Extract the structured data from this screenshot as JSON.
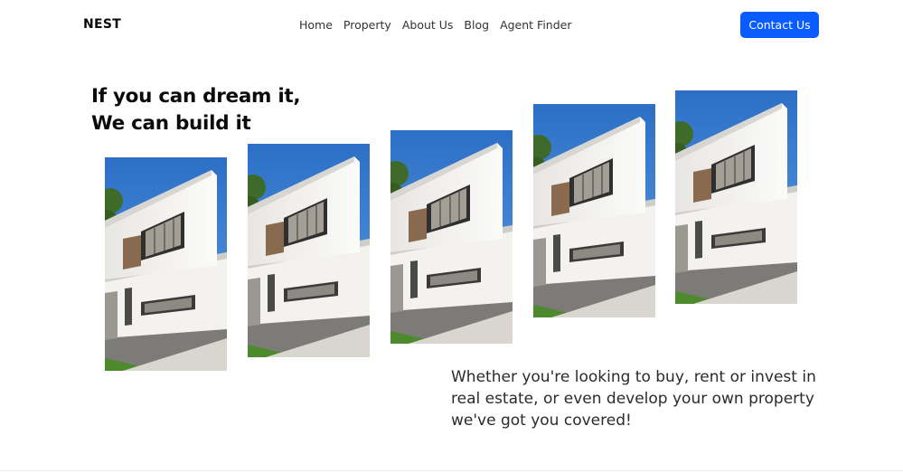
{
  "brand": {
    "name": "NEST"
  },
  "nav": {
    "items": [
      {
        "label": "Home"
      },
      {
        "label": "Property"
      },
      {
        "label": "About Us"
      },
      {
        "label": "Blog"
      },
      {
        "label": "Agent Finder"
      }
    ],
    "cta_label": "Contact Us"
  },
  "hero": {
    "headline_line1": "If you can dream it,",
    "headline_line2": "We can build it",
    "tagline": "Whether you're looking to buy, rent or invest in real estate, or even develop your own property we've got you covered!"
  },
  "gallery": {
    "photo_count": 5,
    "photo_subject": "modern-white-house"
  },
  "colors": {
    "accent": "#0a5cff",
    "sky": "#2e73c9"
  }
}
